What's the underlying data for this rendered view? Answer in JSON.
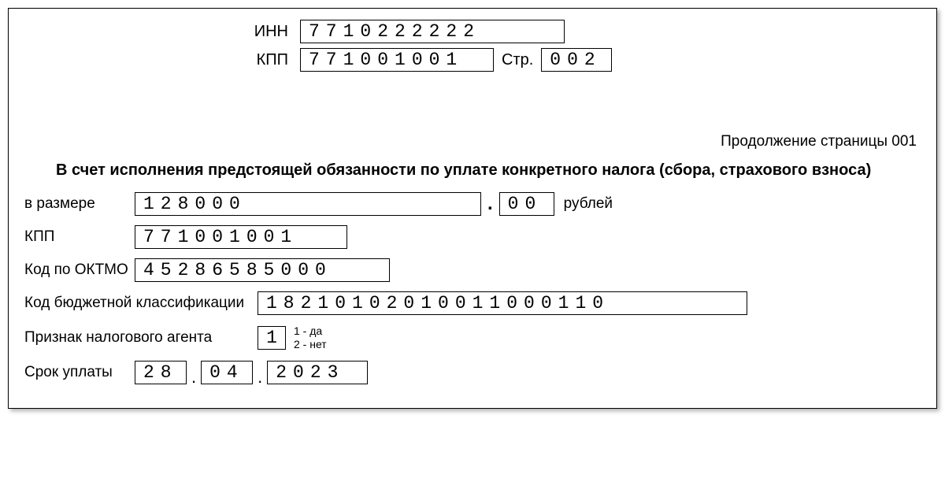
{
  "header": {
    "inn_label": "ИНН",
    "inn_value": "7710222222",
    "kpp_label": "КПП",
    "kpp_value": "771001001",
    "page_label": "Стр.",
    "page_value": "002"
  },
  "continuation_text": "Продолжение страницы 001",
  "section_title": "В счет исполнения предстоящей обязанности по уплате конкретного налога (сбора, страхового взноса)",
  "amount": {
    "label": "в размере",
    "rubles": "128000",
    "kopecks": "00",
    "currency": "рублей"
  },
  "body_kpp": {
    "label": "КПП",
    "value": "771001001"
  },
  "oktmo": {
    "label": "Код по ОКТМО",
    "value": "45286585000"
  },
  "kbk": {
    "label": "Код бюджетной классификации",
    "value": "18210102010011000110"
  },
  "agent": {
    "label": "Признак налогового агента",
    "value": "1",
    "legend_yes": "1 - да",
    "legend_no": "2 - нет"
  },
  "payment_date": {
    "label": "Срок уплаты",
    "day": "28",
    "month": "04",
    "year": "2023"
  }
}
